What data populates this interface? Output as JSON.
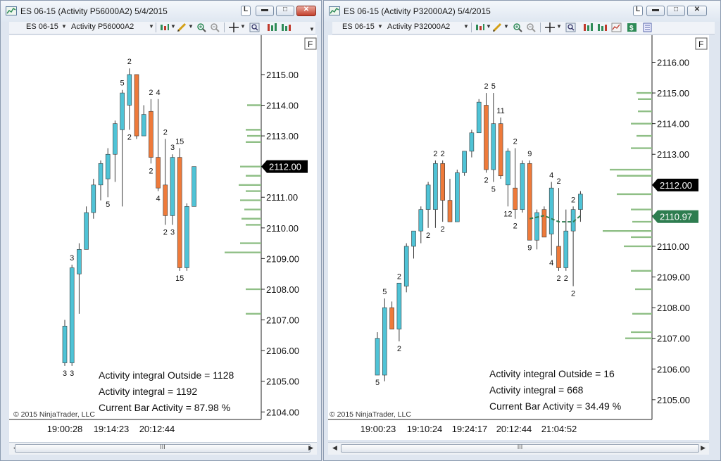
{
  "colors": {
    "up": "#4fc3d6",
    "down": "#ee7a3a",
    "volume": "#8fbf86",
    "avg": "#2e7d50",
    "price_tag_bg": "#000000",
    "price_tag_avg": "#2e7d50",
    "text": "#111111"
  },
  "windows": [
    {
      "title": "ES 06-15 (Activity P56000A2)  5/4/2015",
      "instrument_dropdown": "ES 06-15",
      "bartype_dropdown": "Activity P56000A2",
      "f_button": "F",
      "scroll_thumb": "III",
      "copyright": "© 2015 NinjaTrader, LLC",
      "stats": [
        "Activity integral Outside  = 1128",
        "Activity integral = 1192",
        "Current Bar Activity = 87.98 %"
      ],
      "price_axis": [
        "2115.00",
        "2114.00",
        "2113.00",
        "2112.00",
        "2111.00",
        "2110.00",
        "2109.00",
        "2108.00",
        "2107.00",
        "2106.00",
        "2105.00",
        "2104.00"
      ],
      "time_axis": [
        "19:00:28",
        "19:14:23",
        "20:12:44"
      ],
      "current_price": "2112.00",
      "ymin": 2103.8,
      "ymax": 2116.1,
      "bars": [
        {
          "o": 2105.6,
          "c": 2106.8,
          "h": 2107.0,
          "l": 2105.5,
          "top": "",
          "bot": "3"
        },
        {
          "o": 2105.6,
          "c": 2108.7,
          "h": 2108.8,
          "l": 2105.5,
          "top": "3",
          "bot": "3"
        },
        {
          "o": 2108.5,
          "c": 2109.3,
          "h": 2109.5,
          "l": 2107.2,
          "top": "",
          "bot": ""
        },
        {
          "o": 2109.3,
          "c": 2110.5,
          "h": 2110.7,
          "l": 2109.3,
          "top": "",
          "bot": ""
        },
        {
          "o": 2110.5,
          "c": 2111.4,
          "h": 2111.6,
          "l": 2110.3,
          "top": "",
          "bot": ""
        },
        {
          "o": 2111.4,
          "c": 2112.1,
          "h": 2112.2,
          "l": 2110.9,
          "top": "",
          "bot": ""
        },
        {
          "o": 2111.6,
          "c": 2112.4,
          "h": 2112.6,
          "l": 2111.0,
          "top": "",
          "bot": "5"
        },
        {
          "o": 2112.4,
          "c": 2113.4,
          "h": 2113.5,
          "l": 2111.5,
          "top": "",
          "bot": ""
        },
        {
          "o": 2113.2,
          "c": 2114.4,
          "h": 2114.5,
          "l": 2110.7,
          "top": "5",
          "bot": ""
        },
        {
          "o": 2114.0,
          "c": 2115.0,
          "h": 2115.2,
          "l": 2113.2,
          "top": "2",
          "bot": "2"
        },
        {
          "o": 2115.0,
          "c": 2113.0,
          "h": 2115.0,
          "l": 2112.9,
          "top": "",
          "bot": ""
        },
        {
          "o": 2113.0,
          "c": 2113.7,
          "h": 2114.0,
          "l": 2113.0,
          "top": "",
          "bot": ""
        },
        {
          "o": 2113.8,
          "c": 2112.3,
          "h": 2114.2,
          "l": 2112.1,
          "top": "2",
          "bot": "2"
        },
        {
          "o": 2112.3,
          "c": 2111.3,
          "h": 2114.2,
          "l": 2111.2,
          "top": "4",
          "bot": "4"
        },
        {
          "o": 2111.4,
          "c": 2110.4,
          "h": 2112.9,
          "l": 2110.1,
          "top": "2",
          "bot": "2"
        },
        {
          "o": 2110.4,
          "c": 2112.3,
          "h": 2112.4,
          "l": 2110.1,
          "top": "3",
          "bot": "3"
        },
        {
          "o": 2112.3,
          "c": 2108.7,
          "h": 2112.6,
          "l": 2108.6,
          "top": "15",
          "bot": "15"
        },
        {
          "o": 2108.7,
          "c": 2110.7,
          "h": 2110.8,
          "l": 2108.6,
          "top": "",
          "bot": ""
        },
        {
          "o": 2110.7,
          "c": 2112.0,
          "h": 2112.0,
          "l": 2110.7,
          "top": "",
          "bot": ""
        }
      ],
      "volume_profile": [
        {
          "p": 2114.0,
          "w": 20
        },
        {
          "p": 2113.2,
          "w": 22
        },
        {
          "p": 2113.0,
          "w": 20
        },
        {
          "p": 2112.8,
          "w": 22
        },
        {
          "p": 2112.0,
          "w": 30
        },
        {
          "p": 2111.7,
          "w": 22
        },
        {
          "p": 2111.4,
          "w": 32
        },
        {
          "p": 2111.2,
          "w": 22
        },
        {
          "p": 2110.9,
          "w": 30
        },
        {
          "p": 2110.6,
          "w": 24
        },
        {
          "p": 2110.3,
          "w": 28
        },
        {
          "p": 2110.1,
          "w": 22
        },
        {
          "p": 2109.5,
          "w": 30
        },
        {
          "p": 2109.2,
          "w": 52
        },
        {
          "p": 2108.0,
          "w": 22
        },
        {
          "p": 2107.2,
          "w": 22
        }
      ],
      "avg_line": null
    },
    {
      "title": "ES 06-15 (Activity P32000A2)  5/4/2015",
      "instrument_dropdown": "ES 06-15",
      "bartype_dropdown": "Activity P32000A2",
      "f_button": "F",
      "scroll_thumb": "III",
      "copyright": "© 2015 NinjaTrader, LLC",
      "stats": [
        "Activity integral Outside  = 16",
        "Activity integral = 668",
        "Current Bar Activity = 34.49 %"
      ],
      "price_axis": [
        "2116.00",
        "2115.00",
        "2114.00",
        "2113.00",
        "2112.00",
        "2111.00",
        "2110.00",
        "2109.00",
        "2108.00",
        "2107.00",
        "2106.00",
        "2105.00"
      ],
      "time_axis": [
        "19:00:23",
        "19:10:24",
        "19:24:17",
        "20:12:44",
        "21:04:52"
      ],
      "current_price": "2112.00",
      "avg_price": "2110.97",
      "ymin": 2104.4,
      "ymax": 2116.7,
      "bars": [
        {
          "o": 2105.8,
          "c": 2107.0,
          "h": 2107.2,
          "l": 2105.8,
          "top": "",
          "bot": "5"
        },
        {
          "o": 2105.8,
          "c": 2108.0,
          "h": 2108.3,
          "l": 2105.6,
          "top": "5",
          "bot": ""
        },
        {
          "o": 2108.0,
          "c": 2107.3,
          "h": 2108.2,
          "l": 2107.3,
          "top": "",
          "bot": ""
        },
        {
          "o": 2107.3,
          "c": 2108.8,
          "h": 2108.8,
          "l": 2106.9,
          "top": "2",
          "bot": "2"
        },
        {
          "o": 2108.7,
          "c": 2110.0,
          "h": 2110.1,
          "l": 2108.5,
          "top": "",
          "bot": ""
        },
        {
          "o": 2110.0,
          "c": 2110.5,
          "h": 2110.5,
          "l": 2109.6,
          "top": "",
          "bot": ""
        },
        {
          "o": 2110.5,
          "c": 2111.2,
          "h": 2111.3,
          "l": 2110.1,
          "top": "",
          "bot": ""
        },
        {
          "o": 2111.2,
          "c": 2112.0,
          "h": 2112.1,
          "l": 2110.6,
          "top": "",
          "bot": "2"
        },
        {
          "o": 2111.2,
          "c": 2112.7,
          "h": 2112.8,
          "l": 2110.6,
          "top": "2",
          "bot": ""
        },
        {
          "o": 2112.7,
          "c": 2111.5,
          "h": 2112.8,
          "l": 2110.8,
          "top": "2",
          "bot": "2"
        },
        {
          "o": 2111.5,
          "c": 2110.8,
          "h": 2112.2,
          "l": 2110.8,
          "top": "",
          "bot": ""
        },
        {
          "o": 2110.8,
          "c": 2112.4,
          "h": 2112.5,
          "l": 2110.8,
          "top": "",
          "bot": ""
        },
        {
          "o": 2112.4,
          "c": 2113.1,
          "h": 2113.1,
          "l": 2112.3,
          "top": "",
          "bot": ""
        },
        {
          "o": 2113.1,
          "c": 2113.7,
          "h": 2113.8,
          "l": 2112.9,
          "top": "",
          "bot": ""
        },
        {
          "o": 2113.7,
          "c": 2114.7,
          "h": 2114.8,
          "l": 2113.7,
          "top": "",
          "bot": ""
        },
        {
          "o": 2114.6,
          "c": 2112.5,
          "h": 2115.0,
          "l": 2112.4,
          "top": "2",
          "bot": "2"
        },
        {
          "o": 2112.5,
          "c": 2114.0,
          "h": 2115.0,
          "l": 2112.1,
          "top": "5",
          "bot": "5"
        },
        {
          "o": 2114.0,
          "c": 2112.3,
          "h": 2114.2,
          "l": 2112.2,
          "top": "11",
          "bot": ""
        },
        {
          "o": 2112.0,
          "c": 2113.1,
          "h": 2113.2,
          "l": 2111.3,
          "top": "",
          "bot": "12"
        },
        {
          "o": 2111.9,
          "c": 2111.2,
          "h": 2113.2,
          "l": 2110.9,
          "top": "2",
          "bot": "2"
        },
        {
          "o": 2111.2,
          "c": 2112.7,
          "h": 2112.8,
          "l": 2111.1,
          "top": "",
          "bot": ""
        },
        {
          "o": 2112.7,
          "c": 2110.2,
          "h": 2112.8,
          "l": 2110.2,
          "top": "9",
          "bot": "9"
        },
        {
          "o": 2110.2,
          "c": 2111.1,
          "h": 2111.2,
          "l": 2109.9,
          "top": "",
          "bot": ""
        },
        {
          "o": 2111.2,
          "c": 2110.3,
          "h": 2111.3,
          "l": 2110.3,
          "top": "",
          "bot": ""
        },
        {
          "o": 2110.4,
          "c": 2111.9,
          "h": 2112.1,
          "l": 2109.7,
          "top": "4",
          "bot": "4"
        },
        {
          "o": 2110.0,
          "c": 2109.3,
          "h": 2111.9,
          "l": 2109.2,
          "top": "2",
          "bot": "2"
        },
        {
          "o": 2109.3,
          "c": 2110.5,
          "h": 2111.2,
          "l": 2109.2,
          "top": "",
          "bot": "2"
        },
        {
          "o": 2110.5,
          "c": 2111.2,
          "h": 2111.3,
          "l": 2108.7,
          "top": "2",
          "bot": "2"
        },
        {
          "o": 2111.2,
          "c": 2111.7,
          "h": 2111.8,
          "l": 2110.8,
          "top": "",
          "bot": ""
        }
      ],
      "volume_profile": [
        {
          "p": 2115.0,
          "w": 22
        },
        {
          "p": 2114.8,
          "w": 20
        },
        {
          "p": 2114.4,
          "w": 20
        },
        {
          "p": 2114.0,
          "w": 30
        },
        {
          "p": 2113.6,
          "w": 22
        },
        {
          "p": 2113.2,
          "w": 30
        },
        {
          "p": 2112.5,
          "w": 60
        },
        {
          "p": 2112.3,
          "w": 50
        },
        {
          "p": 2111.7,
          "w": 50
        },
        {
          "p": 2111.2,
          "w": 30
        },
        {
          "p": 2110.8,
          "w": 28
        },
        {
          "p": 2110.5,
          "w": 70
        },
        {
          "p": 2110.3,
          "w": 30
        },
        {
          "p": 2110.0,
          "w": 40
        },
        {
          "p": 2109.2,
          "w": 30
        },
        {
          "p": 2108.6,
          "w": 24
        },
        {
          "p": 2107.8,
          "w": 28
        },
        {
          "p": 2107.2,
          "w": 30
        },
        {
          "p": 2107.0,
          "w": 38
        }
      ],
      "avg_line": [
        {
          "i": 21,
          "p": 2110.9
        },
        {
          "i": 23,
          "p": 2111.0
        },
        {
          "i": 25,
          "p": 2110.8
        },
        {
          "i": 27,
          "p": 2110.8
        },
        {
          "i": 28,
          "p": 2111.0
        }
      ]
    }
  ]
}
